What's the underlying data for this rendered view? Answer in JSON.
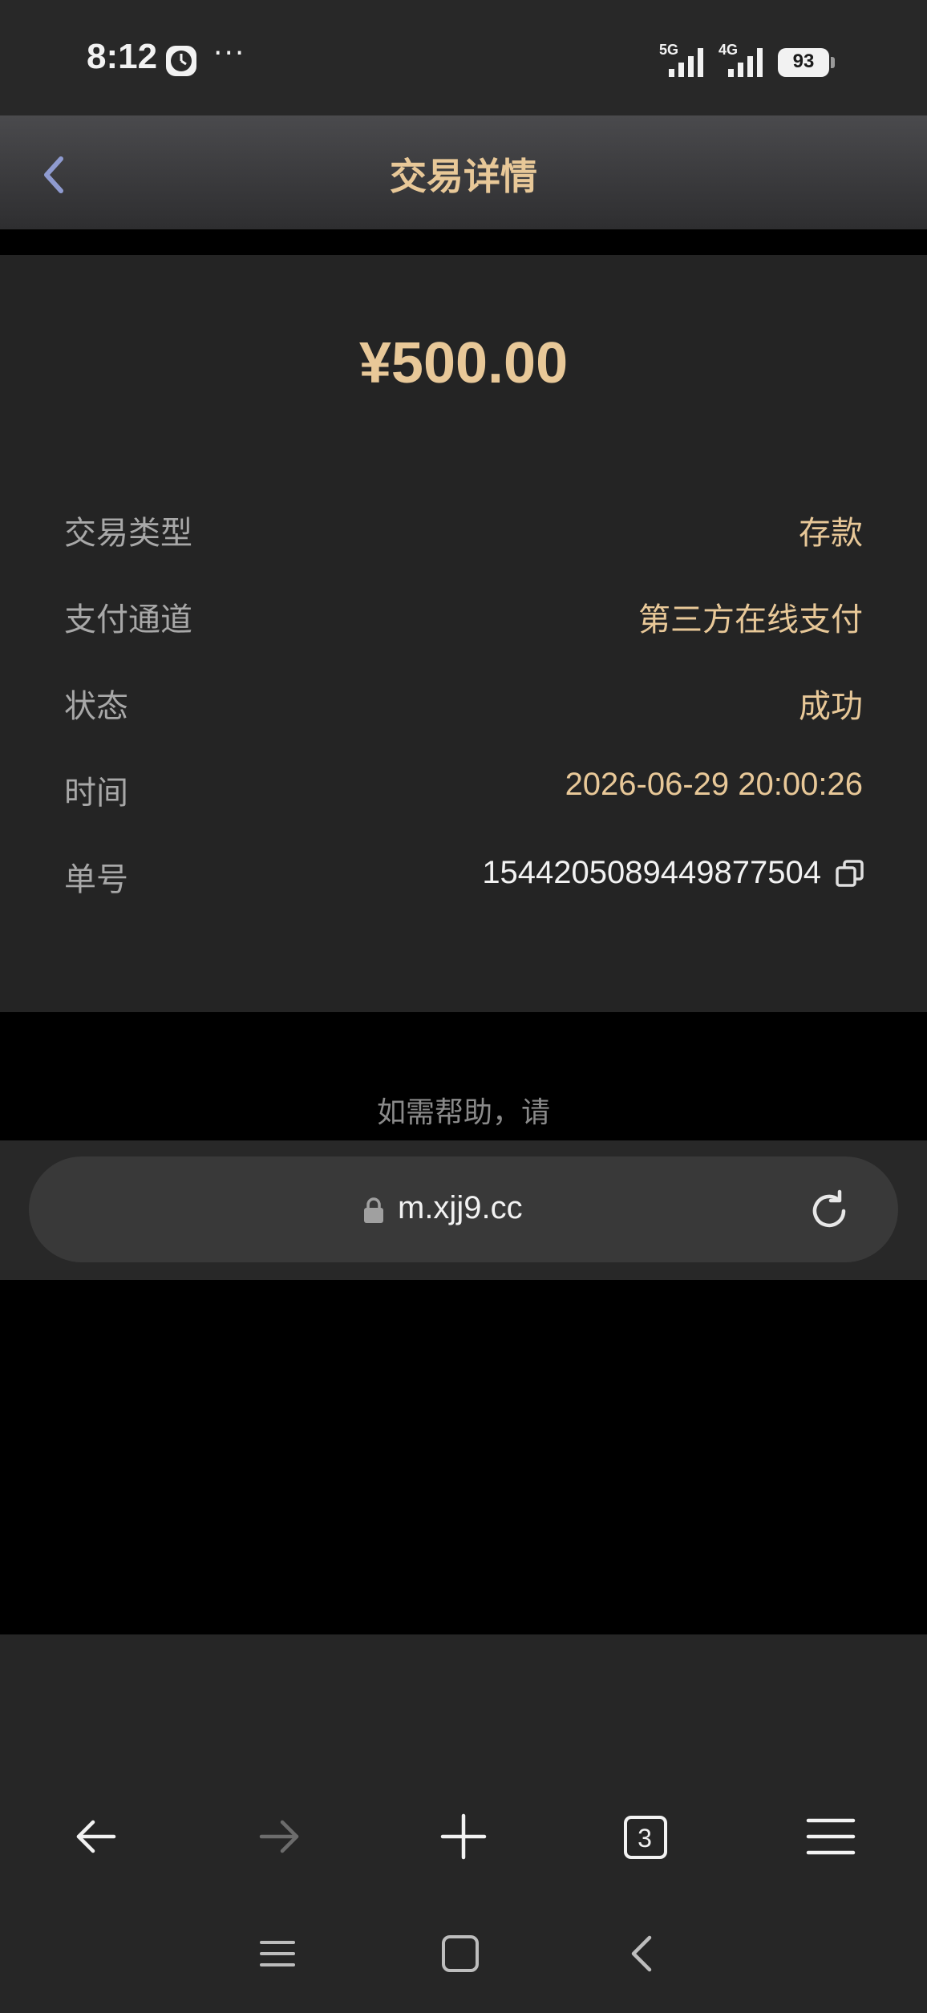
{
  "status_bar": {
    "time": "8:12",
    "more": "···",
    "net1": "5G",
    "net2": "4G",
    "battery": "93"
  },
  "header": {
    "title": "交易详情",
    "back_icon": "chevron-left-icon"
  },
  "detail": {
    "amount": "¥500.00",
    "rows": [
      {
        "label": "交易类型",
        "value": "存款"
      },
      {
        "label": "支付通道",
        "value": "第三方在线支付"
      },
      {
        "label": "状态",
        "value": "成功"
      },
      {
        "label": "时间",
        "value": "2026-06-29 20:00:26"
      },
      {
        "label": "单号",
        "value": "1544205089449877504"
      }
    ]
  },
  "help_text": "如需帮助，请",
  "url_bar": {
    "url": "m.xjj9.cc"
  },
  "browser_nav": {
    "tabs_count": "3"
  },
  "colors": {
    "accent": "#e8c898",
    "background": "#000000",
    "card": "#242424"
  }
}
